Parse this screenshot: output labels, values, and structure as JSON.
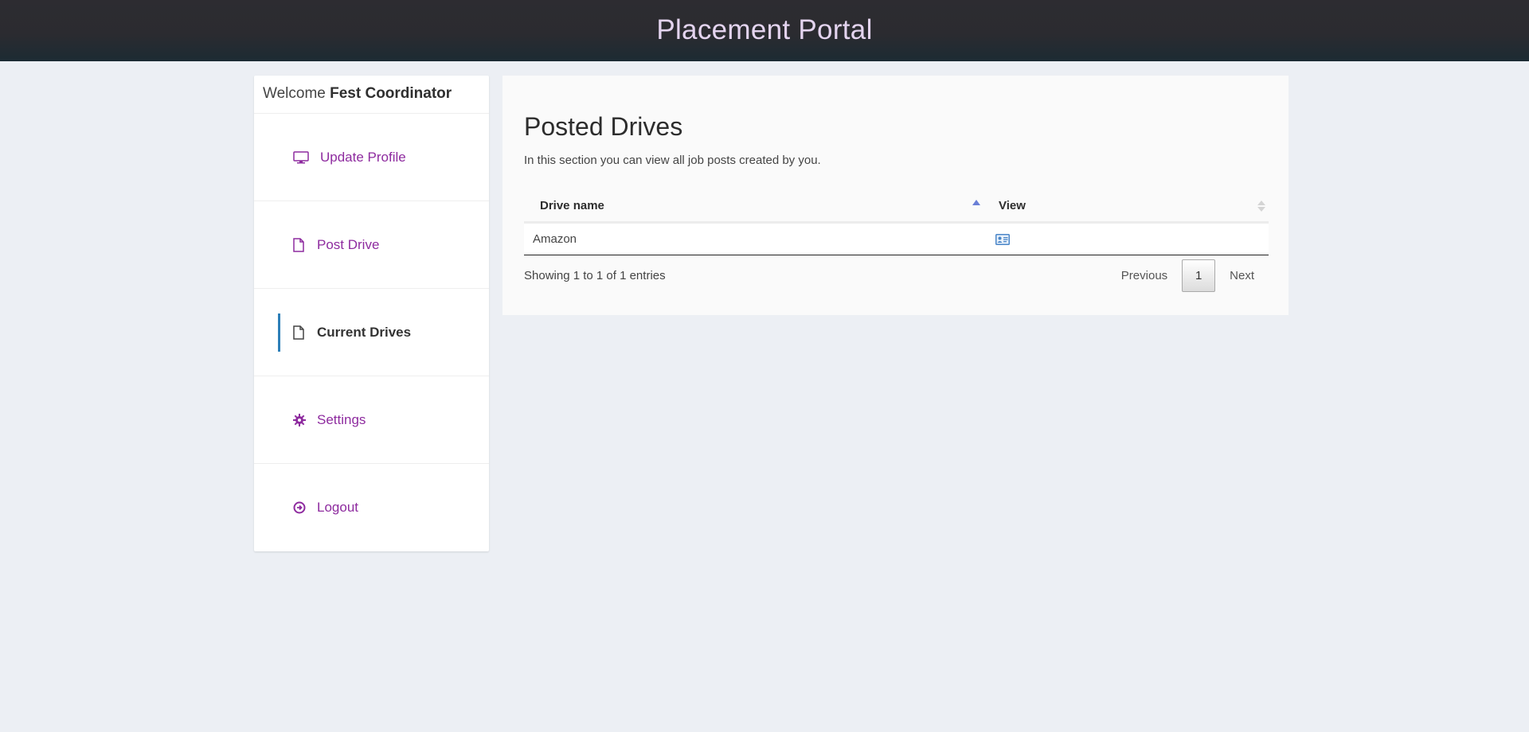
{
  "header": {
    "title": "Placement Portal"
  },
  "sidebar": {
    "welcome_prefix": "Welcome",
    "user_name": "Fest Coordinator",
    "items": [
      {
        "label": "Update Profile",
        "icon": "monitor-icon",
        "active": false
      },
      {
        "label": "Post Drive",
        "icon": "file-icon",
        "active": false
      },
      {
        "label": "Current Drives",
        "icon": "file-icon",
        "active": true
      },
      {
        "label": "Settings",
        "icon": "gear-icon",
        "active": false
      },
      {
        "label": "Logout",
        "icon": "logout-icon",
        "active": false
      }
    ]
  },
  "main": {
    "title": "Posted Drives",
    "description": "In this section you can view all job posts created by you.",
    "table": {
      "columns": [
        "Drive name",
        "View"
      ],
      "rows": [
        {
          "drive_name": "Amazon",
          "view_icon": "id-card-icon"
        }
      ],
      "info": "Showing 1 to 1 of 1 entries",
      "pagination": {
        "previous": "Previous",
        "current_page": "1",
        "next": "Next"
      }
    }
  },
  "colors": {
    "header_bg": "#2d2c31",
    "header_text": "#e4d4ef",
    "nav_link": "#8e2b9f",
    "active_indicator": "#2d7fb8",
    "page_bg": "#eceff4"
  }
}
